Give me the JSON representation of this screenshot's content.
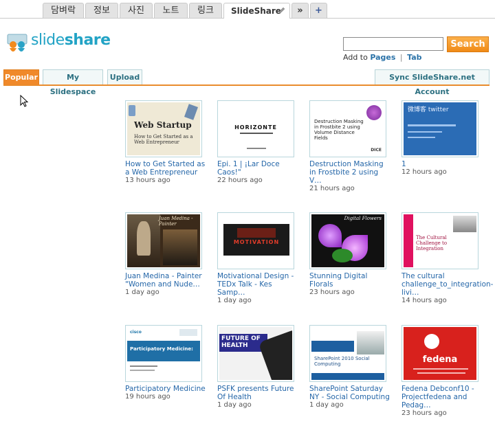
{
  "tabs": [
    {
      "label": "담벼락"
    },
    {
      "label": "정보"
    },
    {
      "label": "사진"
    },
    {
      "label": "노트"
    },
    {
      "label": "링크"
    },
    {
      "label": "SlideShare"
    },
    {
      "label": "»"
    },
    {
      "label": "+"
    }
  ],
  "logo": {
    "part1": "slide",
    "part2": "share"
  },
  "search": {
    "value": "",
    "placeholder": "",
    "button_label": "Search"
  },
  "addto": {
    "prefix": "Add to",
    "pages": "Pages",
    "sep": "|",
    "tab": "Tab"
  },
  "subnav": {
    "popular": "Popular",
    "myslidespace": "My Slidespace",
    "upload": "Upload",
    "sync": "Sync SlideShare.net Account"
  },
  "items": [
    {
      "title": "How to Get Started as a Web Entrepreneur",
      "time": "13 hours ago",
      "thumb_text": "Web Startup",
      "thumb_sub": "How to Get Started as a Web Entrepreneur"
    },
    {
      "title": "Epi. 1 | ¡Lar Doce Caos!\"",
      "time": "22 hours ago",
      "thumb_text": "HORIZONTE"
    },
    {
      "title": "Destruction Masking in Frostbite 2 using V…",
      "time": "21 hours ago",
      "thumb_text": "Destruction Masking in Frostbite 2 using Volume Distance Fields"
    },
    {
      "title": "1",
      "time": "12 hours ago",
      "thumb_text": "微博客 twitter"
    },
    {
      "title": "Juan Medina - Painter \"Women and Nude…",
      "time": "1 day ago",
      "thumb_text": "Juan Medina - Painter"
    },
    {
      "title": "Motivational Design - TEDx Talk - Kes Samp…",
      "time": "1 day ago",
      "thumb_text": "MOTIVATION"
    },
    {
      "title": "Stunning Digital Florals",
      "time": "23 hours ago",
      "thumb_text": "Digital Flowers"
    },
    {
      "title": "The cultural challenge_to_integration-livi…",
      "time": "14 hours ago",
      "thumb_text": "The Cultural Challenge to Integration"
    },
    {
      "title": "Participatory Medicine",
      "time": "19 hours ago",
      "thumb_text": "Participatory Medicine:"
    },
    {
      "title": "PSFK presents Future Of Health",
      "time": "1 day ago",
      "thumb_text": "FUTURE OF HEALTH"
    },
    {
      "title": "SharePoint Saturday NY - Social Computing",
      "time": "1 day ago",
      "thumb_text": "SharePoint 2010 Social Computing"
    },
    {
      "title": "Fedena Debconf10 - Projectfedena and Pedag…",
      "time": "23 hours ago",
      "thumb_text": "fedena"
    }
  ],
  "colors": {
    "accent": "#f0892a",
    "link": "#2466a8",
    "brand": "#22a3c5"
  }
}
